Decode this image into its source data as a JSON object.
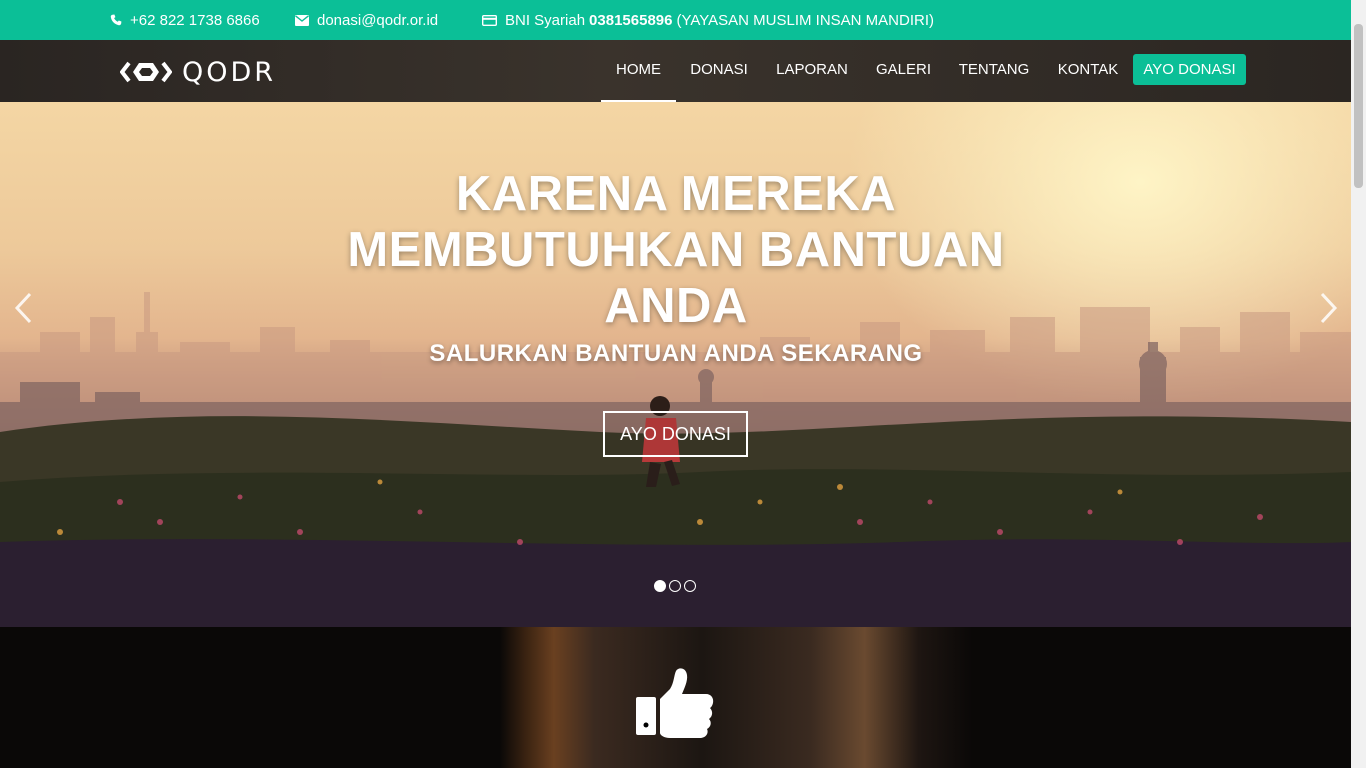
{
  "topbar": {
    "phone": "+62 822 1738 6866",
    "email": "donasi@qodr.or.id",
    "bank_name": "BNI Syariah",
    "bank_account": "0381565896",
    "bank_holder": "(YAYASAN MUSLIM INSAN MANDIRI)",
    "background": "#0bbf97",
    "icons": [
      "phone-icon",
      "envelope-icon",
      "credit-card-icon"
    ]
  },
  "nav": {
    "logo_text": "QODR",
    "items": [
      {
        "label": "HOME",
        "active": true
      },
      {
        "label": "DONASI",
        "active": false
      },
      {
        "label": "LAPORAN",
        "active": false
      },
      {
        "label": "GALERI",
        "active": false
      },
      {
        "label": "TENTANG",
        "active": false
      },
      {
        "label": "KONTAK",
        "active": false
      }
    ],
    "cta_label": "AYO DONASI",
    "accent": "#0bbf97"
  },
  "hero": {
    "title": "KARENA MEREKA MEMBUTUHKAN BANTUAN ANDA",
    "subtitle": "SALURKAN BANTUAN ANDA SEKARANG",
    "button_label": "AYO DONASI",
    "slides": 3,
    "active_slide": 1,
    "icons": [
      "chevron-left-icon",
      "chevron-right-icon"
    ]
  },
  "section": {
    "icon": "thumbs-up-icon"
  }
}
